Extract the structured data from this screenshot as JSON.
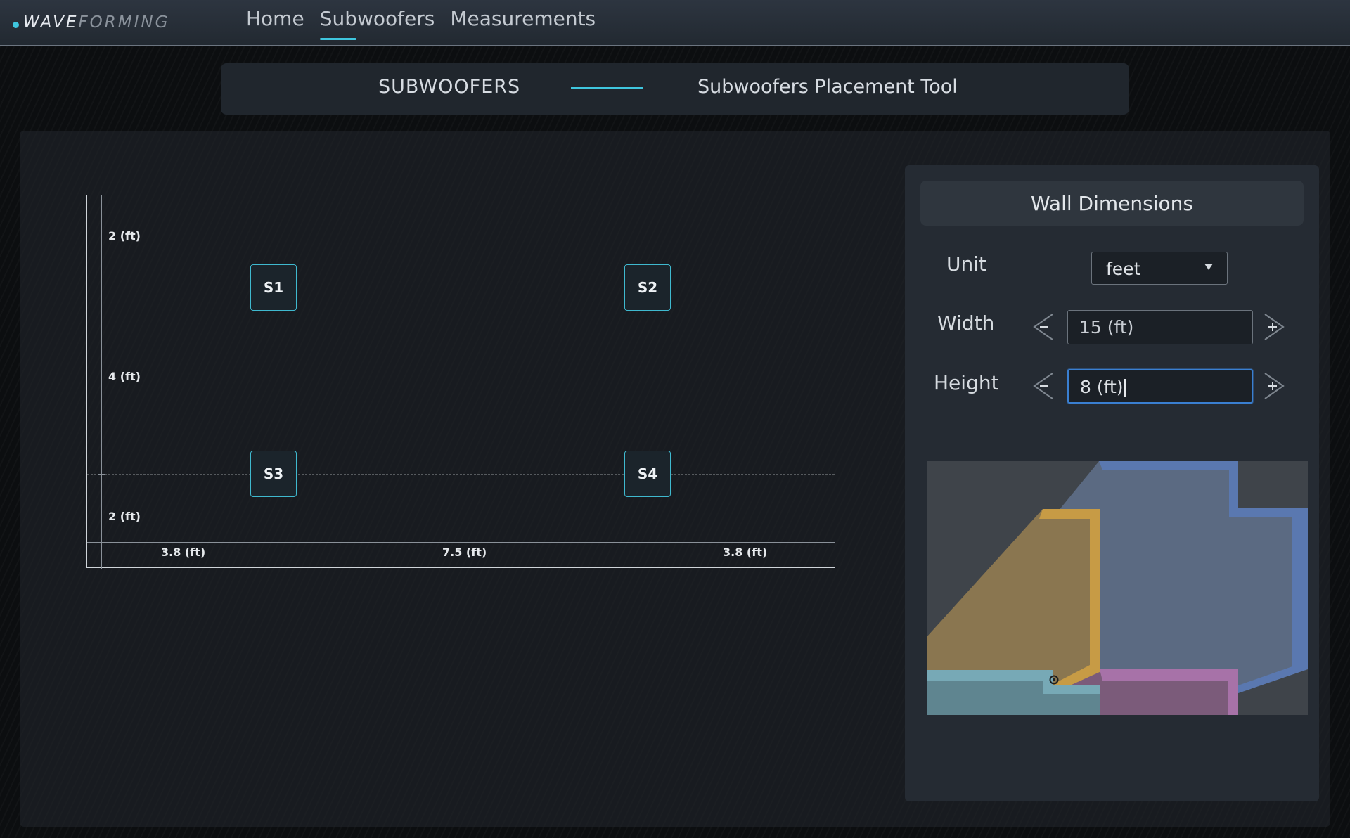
{
  "brand": {
    "part1": "WAVE",
    "part2": "FORMING"
  },
  "nav": {
    "items": [
      "Home",
      "Subwoofers",
      "Measurements"
    ],
    "active": "Subwoofers"
  },
  "breadcrumb": {
    "section": "SUBWOOFERS",
    "page": "Subwoofers Placement Tool"
  },
  "room": {
    "vertical_dims": [
      "2 (ft)",
      "4 (ft)",
      "2 (ft)"
    ],
    "horizontal_dims": [
      "3.8 (ft)",
      "7.5 (ft)",
      "3.8 (ft)"
    ],
    "speakers": [
      "S1",
      "S2",
      "S3",
      "S4"
    ]
  },
  "wall_panel": {
    "title": "Wall Dimensions",
    "unit_label": "Unit",
    "unit_value": "feet",
    "width_label": "Width",
    "width_value": "15 (ft)",
    "height_label": "Height",
    "height_value": "8 (ft)"
  },
  "colors": {
    "accent": "#3fc6de",
    "focus": "#3a7fd1"
  },
  "icons": {
    "minus": "minus-icon",
    "plus": "plus-icon",
    "dropdown": "chevron-down-icon"
  }
}
